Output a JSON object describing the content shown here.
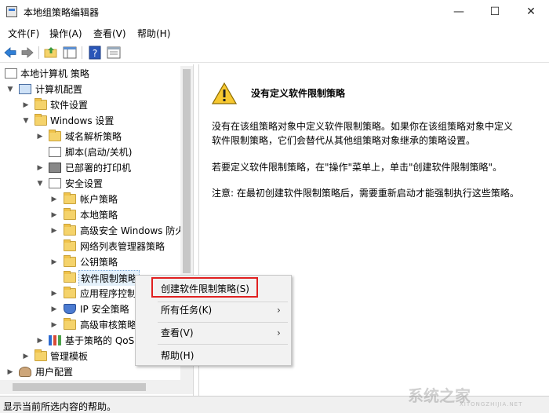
{
  "window": {
    "title": "本地组策略编辑器",
    "min_glyph": "—",
    "max_glyph": "☐",
    "close_glyph": "✕"
  },
  "menu": [
    "文件(F)",
    "操作(A)",
    "查看(V)",
    "帮助(H)"
  ],
  "toolbar": {
    "icons": [
      "back-arrow-icon",
      "forward-arrow-icon",
      "folder-up-icon",
      "console-tree-icon",
      "help-icon",
      "properties-icon"
    ]
  },
  "tree": {
    "root": "本地计算机 策略",
    "computer_config": "计算机配置",
    "software_settings": "软件设置",
    "windows_settings": "Windows 设置",
    "dns_policy": "域名解析策略",
    "scripts": "脚本(启动/关机)",
    "printers": "已部署的打印机",
    "security_settings": "安全设置",
    "account_policies": "帐户策略",
    "local_policies": "本地策略",
    "firewall": "高级安全 Windows 防火墙",
    "network_list": "网络列表管理器策略",
    "public_key": "公钥策略",
    "software_restriction": "软件限制策略",
    "app_control": "应用程序控制策略",
    "ip_security": "IP 安全策略",
    "audit_policy": "高级审核策略配置",
    "qos": "基于策略的 QoS",
    "admin_templates": "管理模板",
    "user_config": "用户配置"
  },
  "content": {
    "heading": "没有定义软件限制策略",
    "para1_line1": "没有在该组策略对象中定义软件限制策略。如果你在该组策略对象中定义",
    "para1_line2": "软件限制策略，它们会替代从其他组策略对象继承的策略设置。",
    "para2": "若要定义软件限制策略，在\"操作\"菜单上，单击\"创建软件限制策略\"。",
    "para3": "注意: 在最初创建软件限制策略后，需要重新启动才能强制执行这些策略。"
  },
  "context_menu": {
    "create": "创建软件限制策略(S)",
    "all_tasks": "所有任务(K)",
    "view": "查看(V)",
    "help": "帮助(H)",
    "submenu_glyph": "›"
  },
  "status": "显示当前所选内容的帮助。",
  "watermark": {
    "text": "系统之家",
    "sub": "XITONGZHIJIA.NET"
  },
  "colors": {
    "highlight_border": "#e02020",
    "selection": "#e5f1fb",
    "menu_bg": "#f2f2f2"
  }
}
